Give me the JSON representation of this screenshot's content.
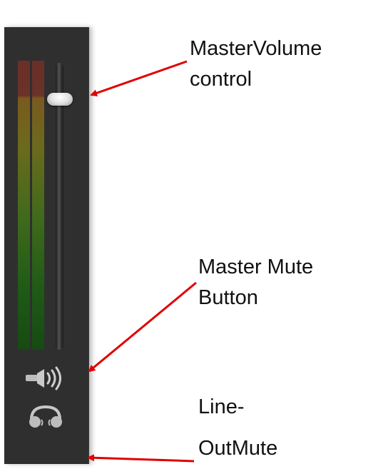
{
  "mixer": {
    "master_volume_level": 0.89,
    "colors": {
      "panel": "#2f2f2f",
      "meter_top": "#6a2f28",
      "meter_mid": "#6b6a1c",
      "meter_bottom": "#164a12",
      "arrow": "#e00000"
    },
    "icons": {
      "master_mute": "speaker-icon",
      "line_out_mute": "headphones-icon"
    }
  },
  "annotations": {
    "master_volume": {
      "line1": "MasterVolume",
      "line2": "control"
    },
    "master_mute": {
      "line1": "Master Mute",
      "line2": "Button"
    },
    "line_out_mute": {
      "line1": "Line-",
      "line2": "OutMute"
    }
  }
}
